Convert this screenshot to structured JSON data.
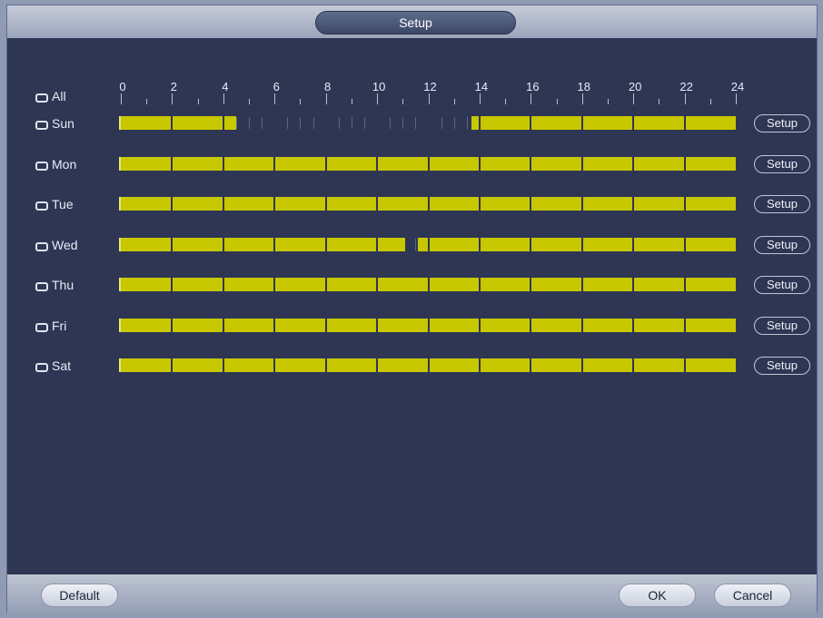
{
  "window": {
    "title": "Setup"
  },
  "scale": {
    "labels": [
      "0",
      "2",
      "4",
      "6",
      "8",
      "10",
      "12",
      "14",
      "16",
      "18",
      "20",
      "22",
      "24"
    ]
  },
  "select_all": {
    "label": "All"
  },
  "days": [
    {
      "label": "Sun",
      "setup_label": "Setup",
      "on_segments": [
        [
          0,
          4.5
        ],
        [
          13.7,
          24
        ]
      ]
    },
    {
      "label": "Mon",
      "setup_label": "Setup",
      "on_segments": [
        [
          0,
          24
        ]
      ]
    },
    {
      "label": "Tue",
      "setup_label": "Setup",
      "on_segments": [
        [
          0,
          24
        ]
      ]
    },
    {
      "label": "Wed",
      "setup_label": "Setup",
      "on_segments": [
        [
          0,
          11.1
        ],
        [
          11.6,
          24
        ]
      ]
    },
    {
      "label": "Thu",
      "setup_label": "Setup",
      "on_segments": [
        [
          0,
          24
        ]
      ]
    },
    {
      "label": "Fri",
      "setup_label": "Setup",
      "on_segments": [
        [
          0,
          24
        ]
      ]
    },
    {
      "label": "Sat",
      "setup_label": "Setup",
      "on_segments": [
        [
          0,
          24
        ]
      ]
    }
  ],
  "footer": {
    "default_label": "Default",
    "ok_label": "OK",
    "cancel_label": "Cancel"
  },
  "colors": {
    "recording": "#c8c800",
    "background": "#2e3654"
  }
}
